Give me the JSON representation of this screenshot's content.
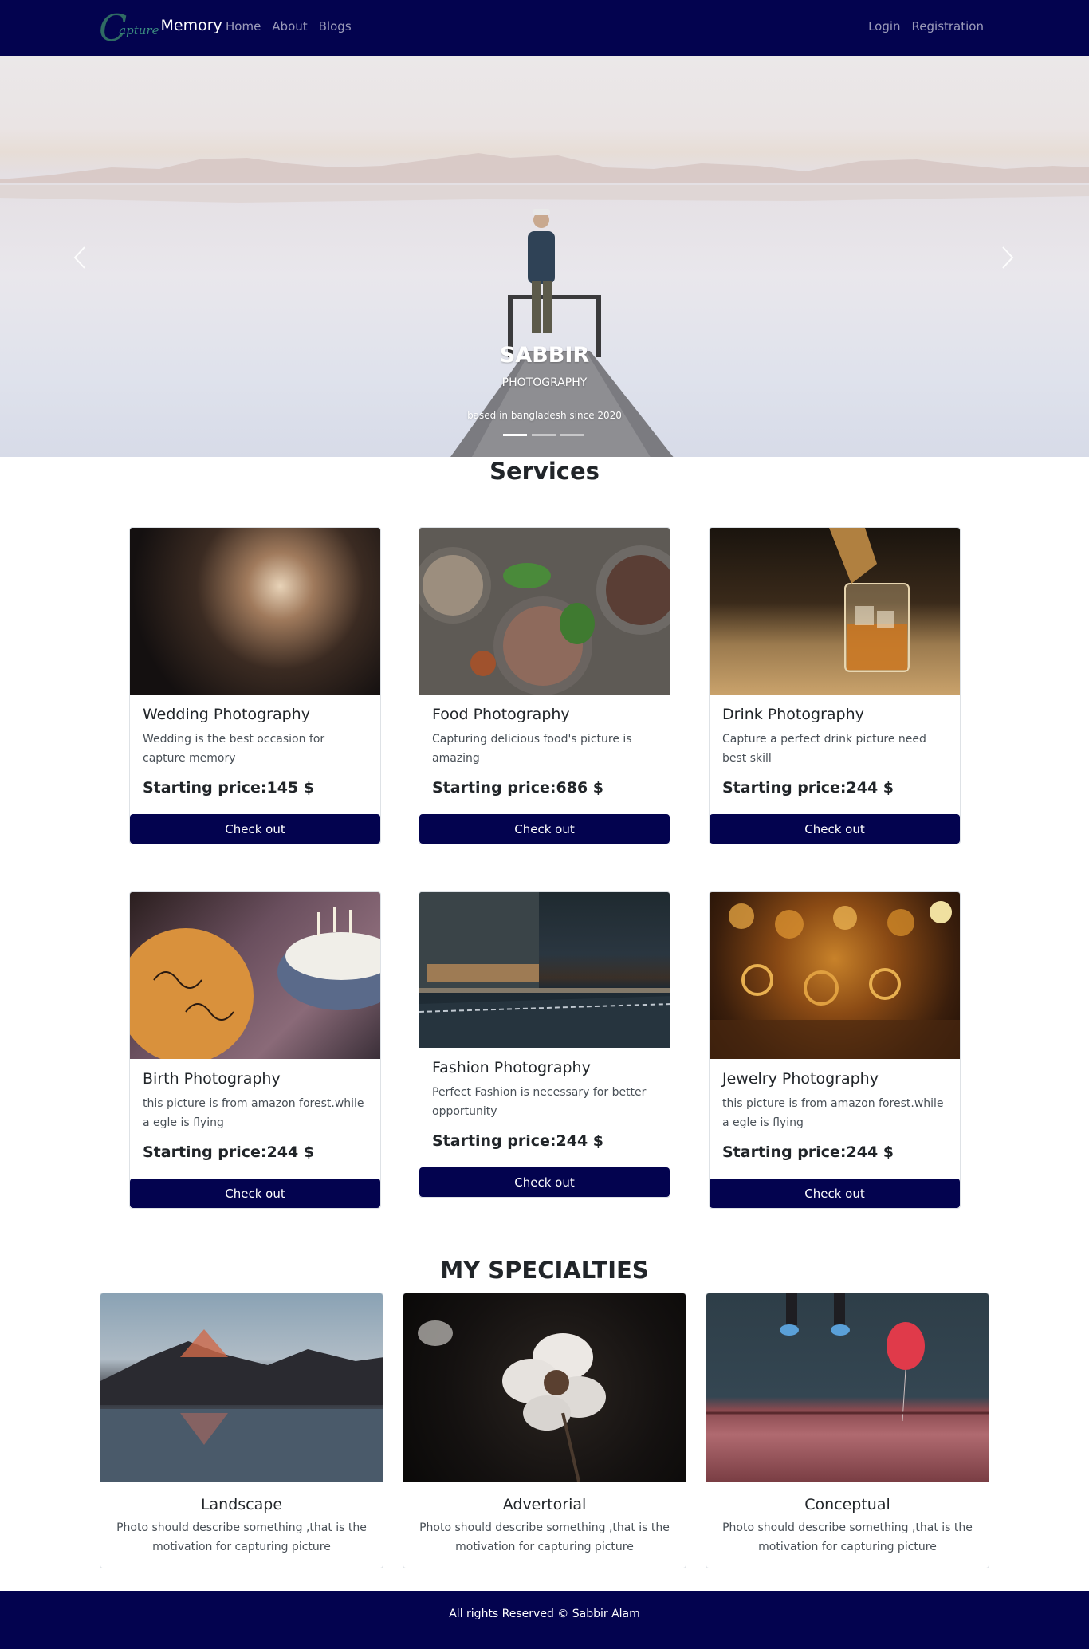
{
  "brand": {
    "prefix": "apture",
    "name": "Memory"
  },
  "nav": {
    "left": [
      {
        "label": "Home"
      },
      {
        "label": "About"
      },
      {
        "label": "Blogs"
      }
    ],
    "right": [
      {
        "label": "Login"
      },
      {
        "label": "Registration"
      }
    ]
  },
  "hero": {
    "title": "SABBIR",
    "subtitle": "PHOTOGRAPHY",
    "note": "based in bangladesh since 2020",
    "prev_icon": "chevron-left-icon",
    "next_icon": "chevron-right-icon",
    "active_slide": 1,
    "slide_count": 3
  },
  "services": {
    "title": "Services",
    "items": [
      {
        "name": "Wedding Photography",
        "desc": "Wedding is the best occasion for capture memory",
        "price": "Starting price:145 $",
        "button": "Check out"
      },
      {
        "name": "Food Photography",
        "desc": "Capturing delicious food's picture is amazing",
        "price": "Starting price:686 $",
        "button": "Check out"
      },
      {
        "name": "Drink Photography",
        "desc": "Capture a perfect drink picture need best skill",
        "price": "Starting price:244 $",
        "button": "Check out"
      },
      {
        "name": "Birth Photography",
        "desc": "this picture is from amazon forest.while a egle is flying",
        "price": "Starting price:244 $",
        "button": "Check out"
      },
      {
        "name": "Fashion Photography",
        "desc": "Perfect Fashion is necessary for better opportunity",
        "price": "Starting price:244 $",
        "button": "Check out"
      },
      {
        "name": "Jewelry Photography",
        "desc": "this picture is from amazon forest.while a egle is flying",
        "price": "Starting price:244 $",
        "button": "Check out"
      }
    ]
  },
  "specialties": {
    "title": "MY SPECIALTIES",
    "items": [
      {
        "name": "Landscape",
        "desc": "Photo should describe something ,that is the motivation for capturing picture"
      },
      {
        "name": "Advertorial",
        "desc": "Photo should describe something ,that is the motivation for capturing picture"
      },
      {
        "name": "Conceptual",
        "desc": "Photo should describe something ,that is the motivation for capturing picture"
      }
    ]
  },
  "footer": {
    "text": "All rights Reserved © Sabbir Alam"
  },
  "colors": {
    "navbar": "#03034f",
    "button": "#03034f",
    "brand_accent": "#2f6b63"
  }
}
